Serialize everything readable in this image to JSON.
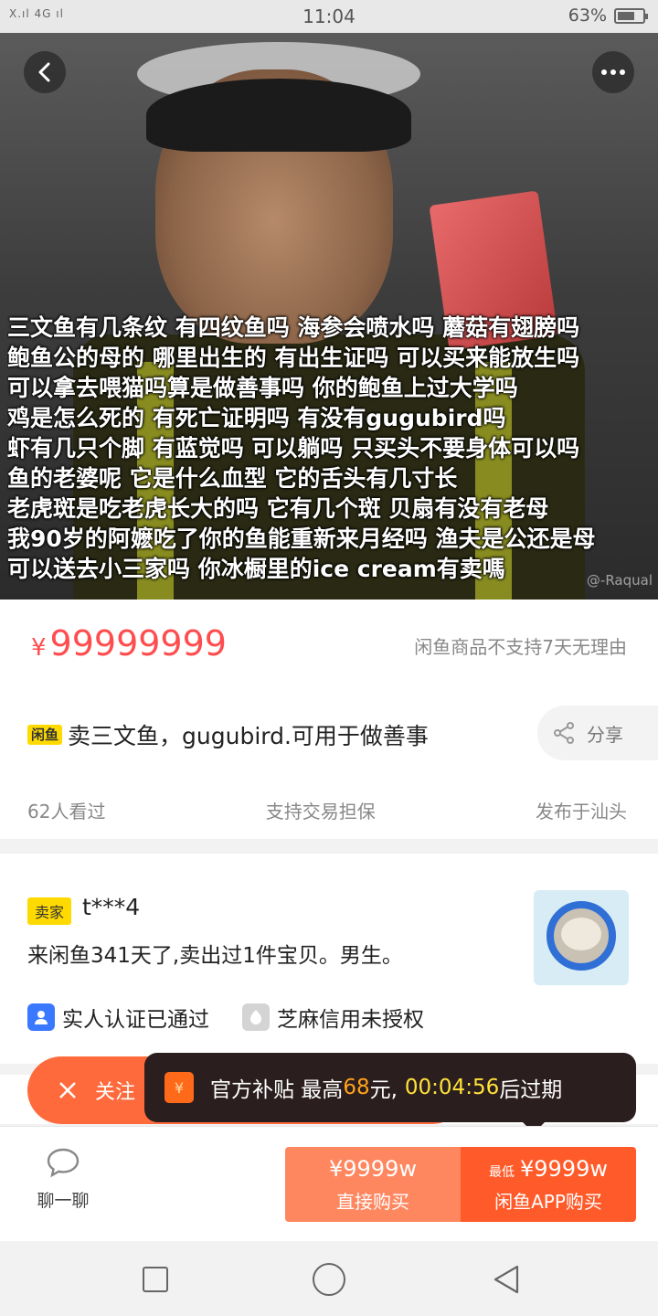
{
  "status_bar": {
    "signal": "X.ıl 4G ıl",
    "time": "11:04",
    "battery": "63%"
  },
  "hero": {
    "caption_lines": [
      "三文鱼有几条纹 有四纹鱼吗 海参会喷水吗 蘑菇有翅膀吗",
      "鲍鱼公的母的 哪里出生的 有出生证吗 可以买来能放生吗",
      "可以拿去喂猫吗算是做善事吗 你的鲍鱼上过大学吗",
      "鸡是怎么死的 有死亡证明吗 有没有gugubird吗",
      "虾有几只个脚 有蓝觉吗 可以躺吗 只买头不要身体可以吗",
      "鱼的老婆呢 它是什么血型 它的舌头有几寸长",
      "老虎斑是吃老虎长大的吗 它有几个斑 贝扇有没有老母",
      "我90岁的阿嬷吃了你的鱼能重新来月经吗 渔夫是公还是母",
      "可以送去小三家吗 你冰橱里的ice cream有卖嗎"
    ],
    "watermark": "@-Raqual"
  },
  "product": {
    "currency": "¥",
    "price": "99999999",
    "policy": "闲鱼商品不支持7天无理由",
    "brand_badge": "闲鱼",
    "title": "卖三文鱼，gugubird.可用于做善事",
    "share_label": "分享",
    "views": "62人看过",
    "guarantee": "支持交易担保",
    "location": "发布于汕头"
  },
  "seller": {
    "tag": "卖家",
    "name": "t***4",
    "description": "来闲鱼341天了,卖出过1件宝贝。男生。",
    "verification": "实人认证已通过",
    "credit": "芝麻信用未授权"
  },
  "follow": {
    "label": "关注"
  },
  "toast": {
    "icon_char": "¥",
    "text_prefix": "官方补贴 最高",
    "amount": "68",
    "text_suffix": "元,",
    "timer": "00:04:56",
    "expire": "后过期"
  },
  "actions": {
    "chat_label": "聊一聊",
    "direct_price": "¥9999w",
    "direct_label": "直接购买",
    "app_low": "最低",
    "app_price": "¥9999w",
    "app_label": "闲鱼APP购买"
  },
  "colors": {
    "price_red": "#ff4d4f",
    "brand_yellow": "#ffda00",
    "buy_light": "#ff8760",
    "buy_dark": "#ff5a29"
  }
}
